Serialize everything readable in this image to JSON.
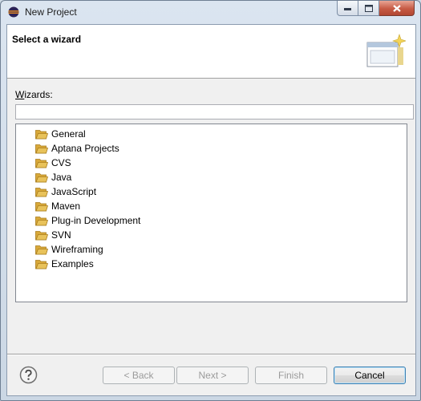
{
  "window": {
    "title": "New Project"
  },
  "header": {
    "title": "Select a wizard"
  },
  "wizards": {
    "label_mnemonic": "W",
    "label_rest": "izards:",
    "filter_value": "",
    "items": [
      {
        "label": "General",
        "icon": "folder-icon"
      },
      {
        "label": "Aptana Projects",
        "icon": "folder-icon"
      },
      {
        "label": "CVS",
        "icon": "folder-icon"
      },
      {
        "label": "Java",
        "icon": "folder-icon"
      },
      {
        "label": "JavaScript",
        "icon": "folder-icon"
      },
      {
        "label": "Maven",
        "icon": "folder-icon"
      },
      {
        "label": "Plug-in Development",
        "icon": "folder-icon"
      },
      {
        "label": "SVN",
        "icon": "folder-icon"
      },
      {
        "label": "Wireframing",
        "icon": "folder-icon"
      },
      {
        "label": "Examples",
        "icon": "folder-icon"
      }
    ]
  },
  "buttons": {
    "back": "< Back",
    "next": "Next >",
    "finish": "Finish",
    "cancel": "Cancel"
  },
  "colors": {
    "window_frame": "#cbd7e4",
    "dialog_bg": "#f0f0f0",
    "header_bg": "#ffffff",
    "folder": "#e8c25a",
    "close_button": "#c65a44"
  }
}
